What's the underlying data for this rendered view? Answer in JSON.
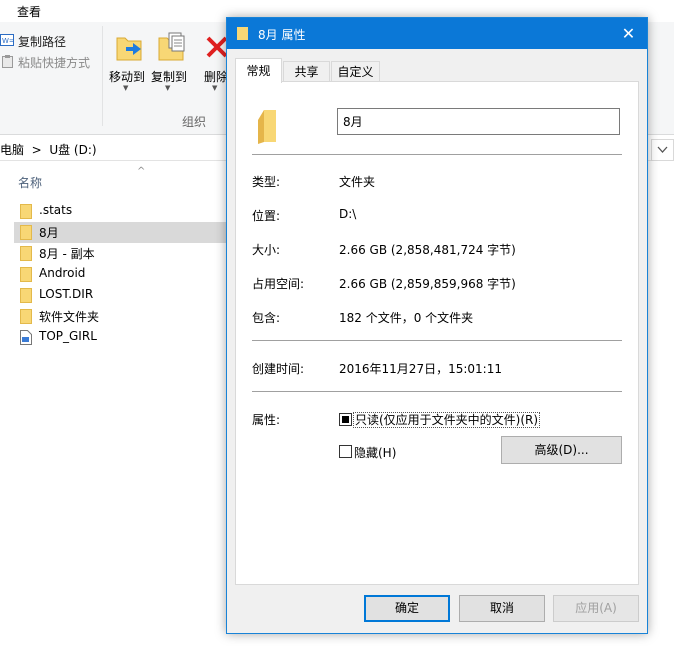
{
  "explorer": {
    "ribbon_tab": "查看",
    "copy_path": "复制路径",
    "paste_shortcut": "粘贴快捷方式",
    "move_to": "移动到",
    "copy_to": "复制到",
    "delete": "删除",
    "group_organize": "组织",
    "address_path": "电脑  >  U盘 (D:)",
    "column_name": "名称",
    "sort_arrow": "^",
    "files": [
      {
        "name": ".stats",
        "type": "folder"
      },
      {
        "name": "8月",
        "type": "folder",
        "selected": true
      },
      {
        "name": "8月 - 副本",
        "type": "folder"
      },
      {
        "name": "Android",
        "type": "folder"
      },
      {
        "name": "LOST.DIR",
        "type": "folder"
      },
      {
        "name": "软件文件夹",
        "type": "folder"
      },
      {
        "name": "TOP_GIRL",
        "type": "file"
      }
    ]
  },
  "dialog": {
    "title": "8月 属性",
    "close_glyph": "✕",
    "tabs": [
      "常规",
      "共享",
      "自定义"
    ],
    "name_value": "8月",
    "fields": {
      "type_label": "类型:",
      "type_value": "文件夹",
      "location_label": "位置:",
      "location_value": "D:\\",
      "size_label": "大小:",
      "size_value": "2.66 GB (2,858,481,724 字节)",
      "disk_label": "占用空间:",
      "disk_value": "2.66 GB (2,859,859,968 字节)",
      "contains_label": "包含:",
      "contains_value": "182 个文件，0 个文件夹",
      "created_label": "创建时间:",
      "created_value": "2016年11月27日，15:01:11",
      "attributes_label": "属性:"
    },
    "readonly_label": "只读(仅应用于文件夹中的文件)(R)",
    "hidden_label": "隐藏(H)",
    "advanced_button": "高级(D)...",
    "ok_button": "确定",
    "cancel_button": "取消",
    "apply_button": "应用(A)"
  },
  "colors": {
    "accent": "#0b78d7",
    "folder": "#f8d775"
  }
}
